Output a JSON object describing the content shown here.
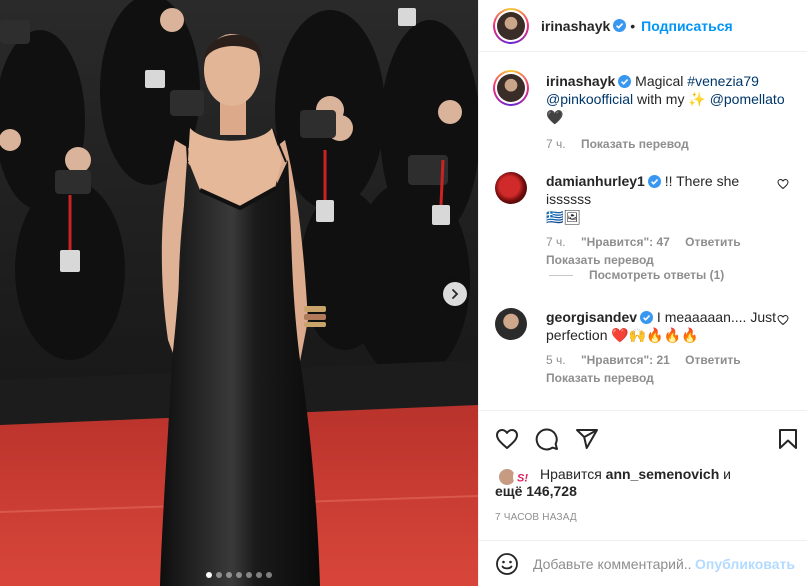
{
  "post": {
    "author": "irinashayk",
    "follow_label": "Подписаться",
    "bullet": "•",
    "image_count": 7,
    "active_image": 0
  },
  "caption": {
    "author": "irinashayk",
    "text_pre": "Magical ",
    "hashtag": "#venezia79",
    "mention1": "@pinkoofficial",
    "text_mid": " with my ",
    "emoji1": "✨",
    "mention2": "@pomellato",
    "emoji2": "🖤",
    "time": "7 ч.",
    "translate": "Показать перевод"
  },
  "comments": [
    {
      "author": "damianhurley1",
      "text": "!! There she issssss",
      "emoji": "🇬🇷🖼",
      "time": "7 ч.",
      "likes": "\"Нравится\": 47",
      "reply": "Ответить",
      "translate": "Показать перевод",
      "replies_label": "Посмотреть ответы (1)"
    },
    {
      "author": "georgisandev",
      "text": "I meaaaaan.... Just perfection ",
      "emoji": "❤️🙌🔥🔥🔥",
      "time": "5 ч.",
      "likes": "\"Нравится\": 21",
      "reply": "Ответить",
      "translate": "Показать перевод"
    }
  ],
  "likes": {
    "prefix": "Нравится ",
    "user": "ann_semenovich",
    "conj": " и",
    "others": "ещё 146,728"
  },
  "timestamp": "7 ЧАСОВ НАЗАД",
  "add_comment": {
    "placeholder": "Добавьте комментарий...",
    "publish": "Опубликовать"
  },
  "icons": {
    "verified": "verified-badge-icon",
    "like": "heart-icon",
    "comment": "comment-icon",
    "share": "paper-plane-icon",
    "save": "bookmark-icon",
    "emoji": "smiley-icon",
    "next": "chevron-right-icon"
  },
  "colors": {
    "link_blue": "#0095f6",
    "tag_blue": "#00376b",
    "muted": "#8e8e8e",
    "publish_disabled": "#b3dbff",
    "carpet": "#c8362e"
  }
}
